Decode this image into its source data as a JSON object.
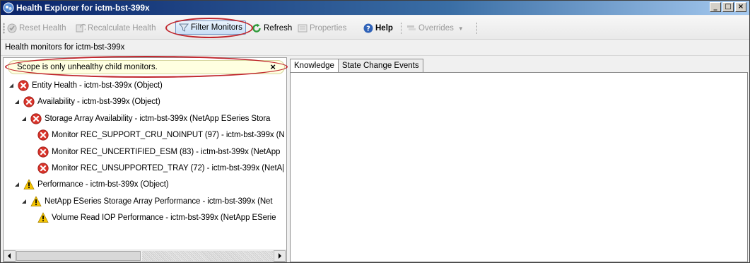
{
  "window": {
    "title": "Health Explorer for ictm-bst-399x",
    "controls": [
      "_",
      "□",
      "×"
    ]
  },
  "toolbar": {
    "reset_health": "Reset Health",
    "recalculate_health": "Recalculate Health",
    "filter_monitors": "Filter Monitors",
    "refresh": "Refresh",
    "properties": "Properties",
    "help": "Help",
    "overrides": "Overrides"
  },
  "subheader": "Health monitors for ictm-bst-399x",
  "scope_banner": {
    "text": "Scope is only unhealthy child monitors.",
    "close": "×"
  },
  "tree": [
    {
      "label": "Entity Health - ictm-bst-399x (Object)",
      "status": "critical",
      "expander": "expanded"
    },
    {
      "label": "Availability - ictm-bst-399x (Object)",
      "status": "critical",
      "expander": "expanded"
    },
    {
      "label": "Storage Array Availability - ictm-bst-399x (NetApp ESeries Stora",
      "status": "critical",
      "expander": "expanded"
    },
    {
      "label": "Monitor REC_SUPPORT_CRU_NOINPUT (97) - ictm-bst-399x (N",
      "status": "critical",
      "expander": "none"
    },
    {
      "label": "Monitor REC_UNCERTIFIED_ESM (83) - ictm-bst-399x (NetApp",
      "status": "critical",
      "expander": "none"
    },
    {
      "label": "Monitor REC_UNSUPPORTED_TRAY (72) - ictm-bst-399x (NetA|",
      "status": "critical",
      "expander": "none"
    },
    {
      "label": "Performance - ictm-bst-399x (Object)",
      "status": "warning",
      "expander": "expanded"
    },
    {
      "label": "NetApp ESeries Storage Array Performance - ictm-bst-399x (Net",
      "status": "warning",
      "expander": "expanded"
    },
    {
      "label": "Volume Read IOP Performance - ictm-bst-399x (NetApp ESerie",
      "status": "warning",
      "expander": "none"
    }
  ],
  "tabs": [
    {
      "label": "Knowledge",
      "active": true
    },
    {
      "label": "State Change Events",
      "active": false
    }
  ],
  "colors": {
    "critical": "#d9342b",
    "warning": "#f5c400",
    "highlight_ellipse": "#c0262d"
  }
}
